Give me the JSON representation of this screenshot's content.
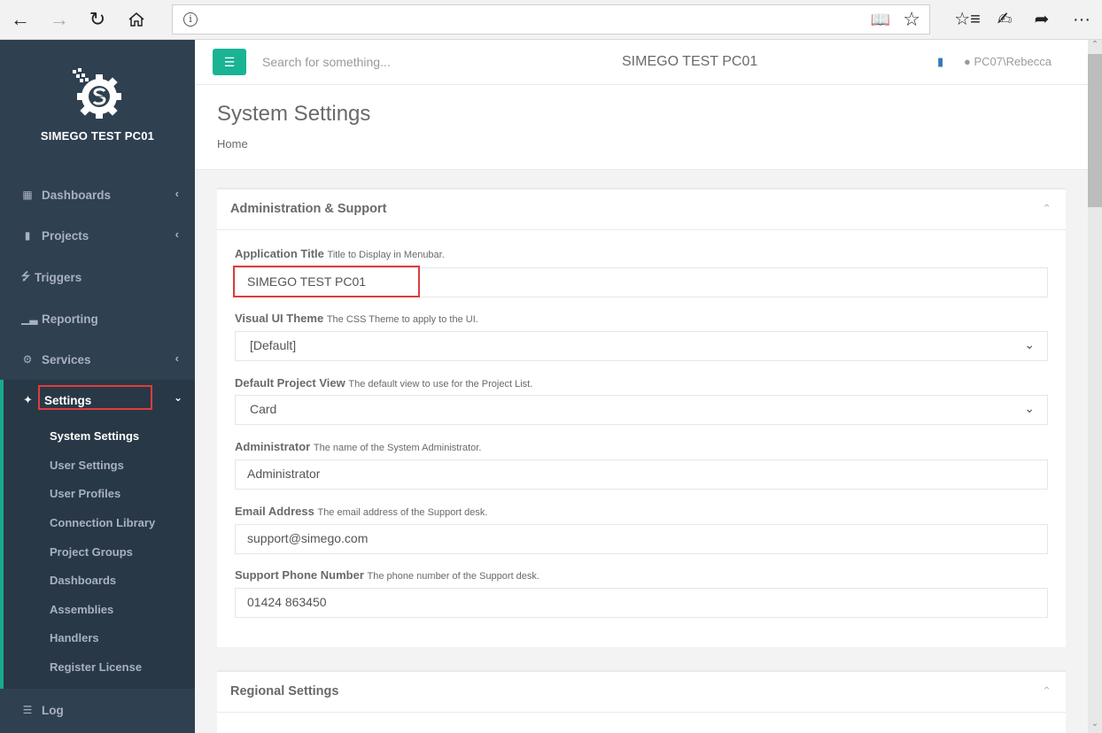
{
  "browser": {
    "back_icon": "arrow-left-icon",
    "forward_icon": "arrow-right-icon",
    "refresh_icon": "refresh-icon",
    "home_icon": "home-icon",
    "address_value": "",
    "info_glyph": "i",
    "reading_view_icon": "book-open-icon",
    "favorite_icon": "star-icon",
    "favorites_list_icon": "favorites-list-icon",
    "notes_icon": "pen-icon",
    "share_icon": "share-icon",
    "more_glyph": "···"
  },
  "sidebar": {
    "brand": "SIMEGO TEST PC01",
    "items": [
      {
        "label": "Dashboards",
        "icon": "grid-icon",
        "has_chevron": true
      },
      {
        "label": "Projects",
        "icon": "book-icon",
        "has_chevron": true
      },
      {
        "label": "Triggers",
        "icon": "bolt-icon",
        "has_chevron": false
      },
      {
        "label": "Reporting",
        "icon": "bar-chart-icon",
        "has_chevron": false
      },
      {
        "label": "Services",
        "icon": "cogs-icon",
        "has_chevron": true
      }
    ],
    "settings": {
      "label": "Settings",
      "icon": "magic-wand-icon",
      "expanded": true,
      "subitems": [
        {
          "label": "System Settings",
          "active": true
        },
        {
          "label": "User Settings"
        },
        {
          "label": "User Profiles"
        },
        {
          "label": "Connection Library"
        },
        {
          "label": "Project Groups"
        },
        {
          "label": "Dashboards"
        },
        {
          "label": "Assemblies"
        },
        {
          "label": "Handlers"
        },
        {
          "label": "Register License"
        }
      ]
    },
    "log": {
      "label": "Log",
      "icon": "list-icon"
    }
  },
  "topbar": {
    "search_placeholder": "Search for something...",
    "title": "SIMEGO TEST PC01",
    "user": "PC07\\Rebecca"
  },
  "page": {
    "title": "System Settings",
    "breadcrumb": "Home"
  },
  "panels": [
    {
      "title": "Administration & Support",
      "fields": [
        {
          "label": "Application Title",
          "hint": "Title to Display in Menubar.",
          "value": "SIMEGO TEST PC01",
          "type": "text"
        },
        {
          "label": "Visual UI Theme",
          "hint": "The CSS Theme to apply to the UI.",
          "value": "[Default]",
          "type": "select"
        },
        {
          "label": "Default Project View",
          "hint": "The default view to use for the Project List.",
          "value": "Card",
          "type": "select"
        },
        {
          "label": "Administrator",
          "hint": "The name of the System Administrator.",
          "value": "Administrator",
          "type": "text"
        },
        {
          "label": "Email Address",
          "hint": "The email address of the Support desk.",
          "value": "support@simego.com",
          "type": "text"
        },
        {
          "label": "Support Phone Number",
          "hint": "The phone number of the Support desk.",
          "value": "01424 863450",
          "type": "text"
        }
      ]
    },
    {
      "title": "Regional Settings",
      "fields": []
    }
  ],
  "colors": {
    "sidebar_bg": "#2f4050",
    "accent": "#1ab394",
    "highlight": "#e03c3c"
  }
}
